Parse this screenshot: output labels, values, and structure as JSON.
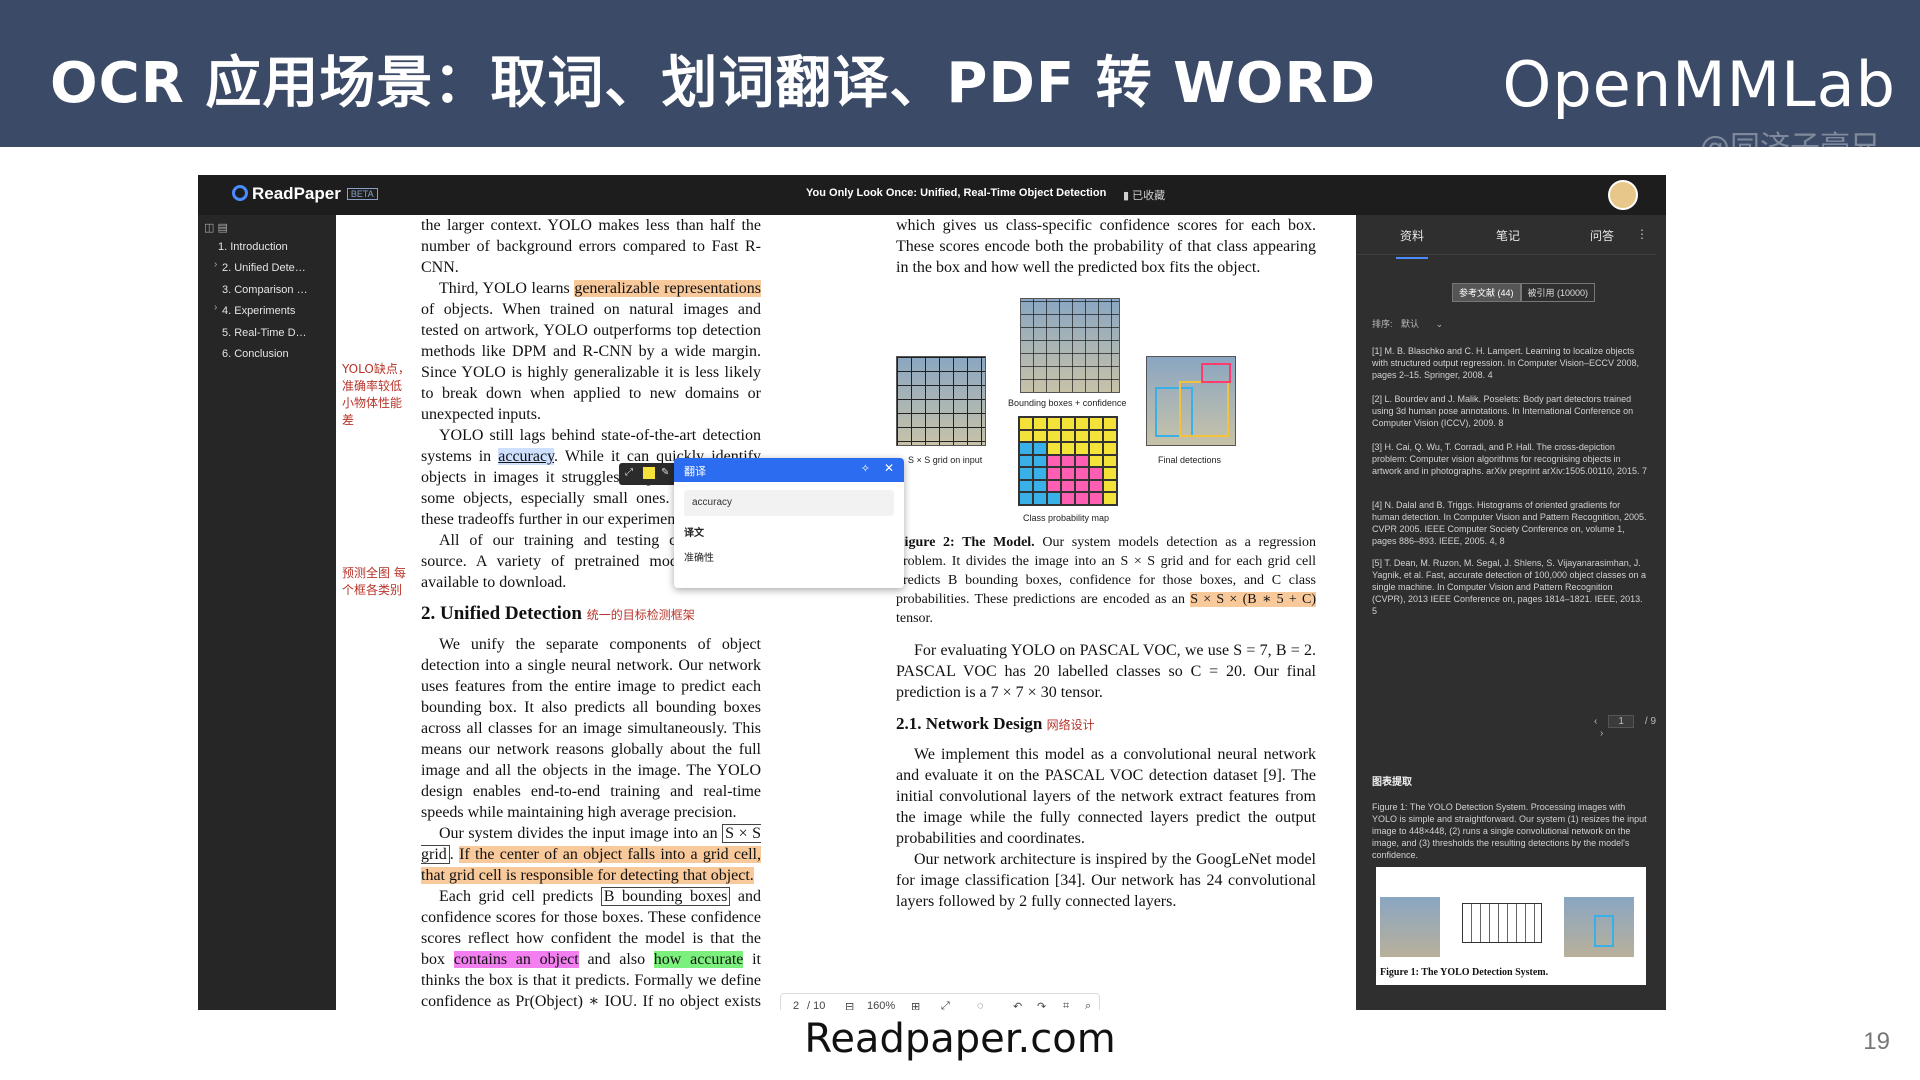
{
  "slide": {
    "title": "OCR 应用场景：取词、划词翻译、PDF 转 WORD",
    "brand": "OpenMMLab",
    "watermark": "@同济子豪兄",
    "footer_url": "Readpaper.com",
    "page_number": "19"
  },
  "app": {
    "logo": "ReadPaper",
    "beta": "BETA",
    "doc_title": "You Only Look Once: Unified, Real-Time Object Detection",
    "bookmark": "已收藏"
  },
  "toc": {
    "items": [
      {
        "label": "1. Introduction"
      },
      {
        "label": "2. Unified Dete…"
      },
      {
        "label": "3. Comparison …"
      },
      {
        "label": "4. Experiments"
      },
      {
        "label": "5. Real-Time D…"
      },
      {
        "label": "6. Conclusion"
      }
    ]
  },
  "paper": {
    "left": {
      "p0": "the larger context. YOLO makes less than half the number of background errors compared to Fast R-CNN.",
      "p1a": "Third, YOLO learns ",
      "p1hl": "generalizable representations",
      "p1b": " of objects. When trained on natural images and tested on artwork, YOLO outperforms top detection methods like DPM and R-CNN by a wide margin. Since YOLO is highly generalizable it is less likely to break down when applied to new domains or unexpected inputs.",
      "p2a": "YOLO still lags behind state-of-the-art detection systems in ",
      "p2word": "accuracy",
      "p2b": ". While it can quickly identify objects in images it struggles to precisely localize some objects, especially small ones. We examine these tradeoffs further in our experiments.",
      "p3": "All of our training and testing code is open source. A variety of pretrained models are also available to download.",
      "section": "2. Unified Detection",
      "p4": "We unify the separate components of object detection into a single neural network. Our network uses features from the entire image to predict each bounding box. It also predicts all bounding boxes across all classes for an image simultaneously. This means our network reasons globally about the full image and all the objects in the image. The YOLO design enables end-to-end training and real-time speeds while maintaining high average precision.",
      "p5a": "Our system divides the input image into an ",
      "p5box": "S × S grid",
      "p5b": ". ",
      "p5hl": "If the center of an object falls into a grid cell, that grid cell is responsible for detecting that object.",
      "p6a": "Each grid cell predicts ",
      "p6box": "B bounding boxes",
      "p6b": " and confidence scores for those boxes. These confidence scores reflect how confident the model is that the box ",
      "p6pink": "contains an object",
      "p6c": " and also ",
      "p6green": "how accurate",
      "p6d": " it thinks the box is that it predicts. Formally we define confidence as Pr(Object) ∗ IOU. If no object exists in that cell, the confidence scores should be zero. Otherwise we want the confidence score to equal the intersection over union (IOU) between the predicted box and the ground truth."
    },
    "right": {
      "p0": "which gives us class-specific confidence scores for each box. These scores encode both the probability of that class appearing in the box and how well the predicted box fits the object.",
      "fig_bbox": "Bounding boxes + confidence",
      "fig_grid": "S × S grid on input",
      "fig_final": "Final detections",
      "fig_classmap": "Class probability map",
      "cap_bold": "Figure 2: The Model.",
      "cap_text": " Our system models detection as a regression problem. It divides the image into an S × S grid and for each grid cell predicts B bounding boxes, confidence for those boxes, and C class probabilities. These predictions are encoded as an ",
      "cap_hl": "S × S × (B ∗ 5 + C)",
      "cap_end": " tensor.",
      "p1": "For evaluating YOLO on PASCAL VOC, we use S = 7, B = 2. PASCAL VOC has 20 labelled classes so C = 20. Our final prediction is a 7 × 7 × 30 tensor.",
      "section": "2.1. Network Design",
      "p2": "We implement this model as a convolutional neural network and evaluate it on the PASCAL VOC detection dataset [9]. The initial convolutional layers of the network extract features from the image while the fully connected layers predict the output probabilities and coordinates.",
      "p3": "Our network architecture is inspired by the GoogLeNet model for image classification [34]. Our network has 24 convolutional layers followed by 2 fully connected layers."
    },
    "notes": {
      "yolo_weak": "YOLO缺点，准确率较低 小物体性能差",
      "unified": "统一的目标检测框架",
      "predict": "预测全图 每个框各类别",
      "network": "网络设计"
    }
  },
  "popup": {
    "title": "翻译",
    "input": "accuracy",
    "label": "译文",
    "result": "准确性"
  },
  "pdf_toolbar": {
    "page": "2",
    "total": "/ 10",
    "zoom": "160%"
  },
  "right_panel": {
    "tabs": [
      {
        "label": "资料"
      },
      {
        "label": "笔记"
      },
      {
        "label": "问答"
      }
    ],
    "seg_refs": "参考文献 (44)",
    "seg_cited": "被引用 (10000)",
    "sort_label": "排序:",
    "sort_value": "默认",
    "refs": [
      "[1] M. B. Blaschko and C. H. Lampert. Learning to localize objects with structured output regression. In Computer Vision–ECCV 2008, pages 2–15. Springer, 2008. 4",
      "[2] L. Bourdev and J. Malik. Poselets: Body part detectors trained using 3d human pose annotations. In International Conference on Computer Vision (ICCV), 2009. 8",
      "[3] H. Cai, Q. Wu, T. Corradi, and P. Hall. The cross-depiction problem: Computer vision algorithms for recognising objects in artwork and in photographs. arXiv preprint arXiv:1505.00110, 2015. 7",
      "[4] N. Dalal and B. Triggs. Histograms of oriented gradients for human detection. In Computer Vision and Pattern Recognition, 2005. CVPR 2005. IEEE Computer Society Conference on, volume 1, pages 886–893. IEEE, 2005. 4, 8",
      "[5] T. Dean, M. Ruzon, M. Segal, J. Shlens, S. Vijayanarasimhan, J. Yagnik, et al. Fast, accurate detection of 100,000 object classes on a single machine. In Computer Vision and Pattern Recognition (CVPR), 2013 IEEE Conference on, pages 1814–1821. IEEE, 2013. 5"
    ],
    "pager_current": "1",
    "pager_total": "/ 9",
    "section_title": "图表提取",
    "figure_caption": "Figure 1: The YOLO Detection System. Processing images with YOLO is simple and straightforward. Our system (1) resizes the input image to 448×448, (2) runs a single convolutional network on the image, and (3) thresholds the resulting detections by the model's confidence.",
    "thumb_caption": "Figure 1: The YOLO Detection System."
  },
  "colors": {
    "header_bg": "#3b4a66",
    "accent": "#2c6cf0",
    "highlight_orange": "#f8c99a",
    "highlight_green": "#7cf07c",
    "highlight_pink": "#f37ef0"
  }
}
